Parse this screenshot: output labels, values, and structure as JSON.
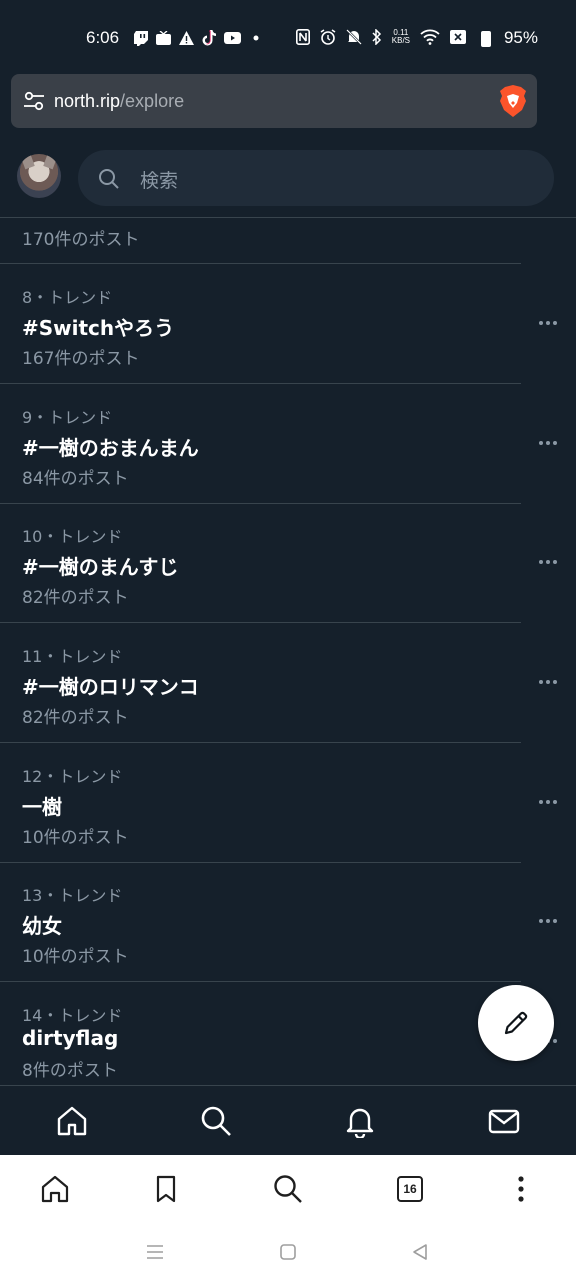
{
  "status_bar": {
    "time": "6:06",
    "network_speed_value": "0.11",
    "network_speed_unit": "KB/S",
    "battery": "95%"
  },
  "url_bar": {
    "host": "north.rip",
    "path": "/explore"
  },
  "header": {
    "search_placeholder": "検索"
  },
  "trends": {
    "partial_count": "170件のポスト",
    "items": [
      {
        "meta": "8・トレンド",
        "title": "#Switchやろう",
        "count": "167件のポスト"
      },
      {
        "meta": "9・トレンド",
        "title": "#一樹のおまんまん",
        "count": "84件のポスト"
      },
      {
        "meta": "10・トレンド",
        "title": "#一樹のまんすじ",
        "count": "82件のポスト"
      },
      {
        "meta": "11・トレンド",
        "title": "#一樹のロリマンコ",
        "count": "82件のポスト"
      },
      {
        "meta": "12・トレンド",
        "title": "一樹",
        "count": "10件のポスト"
      },
      {
        "meta": "13・トレンド",
        "title": "幼女",
        "count": "10件のポスト"
      },
      {
        "meta": "14・トレンド",
        "title": "dirtyflag",
        "count": "8件のポスト"
      }
    ]
  },
  "browser_bar": {
    "tab_count": "16"
  },
  "colors": {
    "background": "#15202b",
    "divider": "#38444d",
    "secondary_text": "#8b98a5",
    "brave_orange": "#fb542b"
  }
}
